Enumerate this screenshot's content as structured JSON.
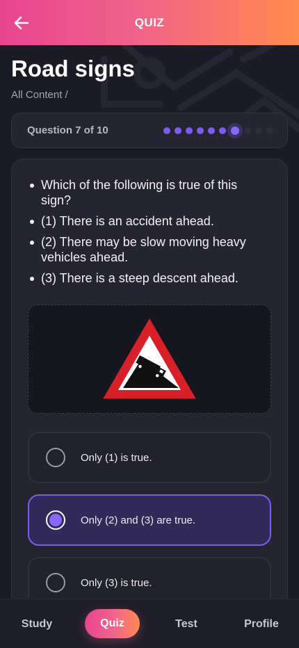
{
  "header": {
    "title": "QUIZ",
    "back_icon": "arrow-left-icon",
    "gradient_start": "#e8458f",
    "gradient_end": "#ff8a4c"
  },
  "page": {
    "title": "Road signs",
    "breadcrumb": "All Content /"
  },
  "progress": {
    "label": "Question 7 of 10",
    "current": 7,
    "total": 10
  },
  "question": {
    "lines": [
      "Which of the following is true of this sign?",
      "(1) There is an accident ahead.",
      "(2) There may be slow moving heavy vehicles ahead.",
      "(3) There is a steep descent ahead."
    ],
    "sign_icon": "steep-descent-warning-sign"
  },
  "options": [
    {
      "label": "Only (1) is true.",
      "selected": false
    },
    {
      "label": "Only (2) and (3) are true.",
      "selected": true
    },
    {
      "label": "Only (3) is true.",
      "selected": false
    }
  ],
  "nav": {
    "items": [
      {
        "label": "Study",
        "active": false
      },
      {
        "label": "Quiz",
        "active": true
      },
      {
        "label": "Test",
        "active": false
      },
      {
        "label": "Profile",
        "active": false
      }
    ]
  },
  "colors": {
    "accent": "#7e5cf0",
    "background": "#1b1b26",
    "card": "#252531"
  }
}
